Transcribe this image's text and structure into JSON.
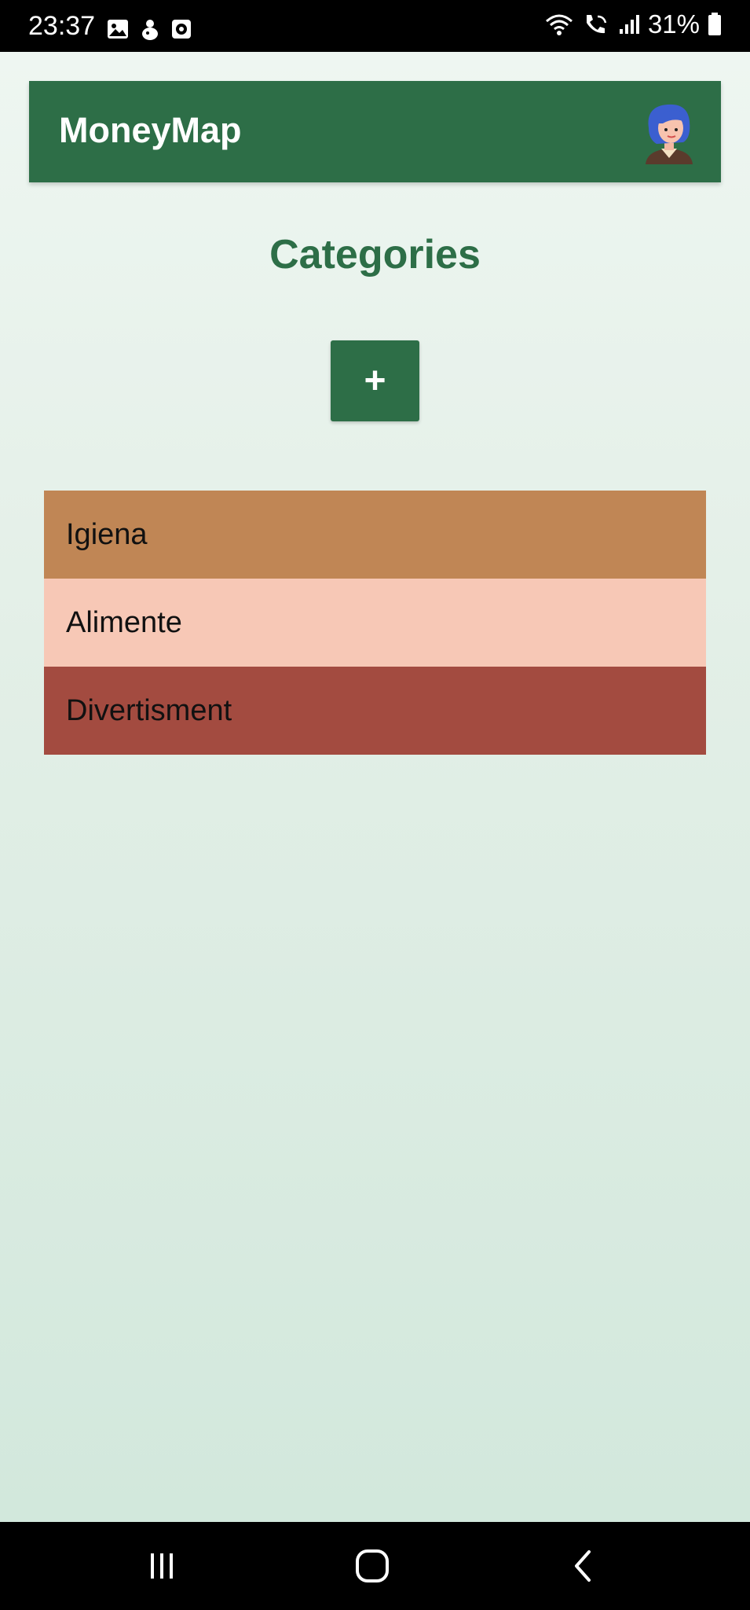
{
  "status_bar": {
    "time": "23:37",
    "battery": "31%",
    "left_icons": [
      "gallery-icon",
      "notification-icon",
      "clock-app-icon"
    ],
    "right_icons": [
      "wifi-icon",
      "wifi-calling-icon",
      "signal-icon",
      "battery-icon"
    ]
  },
  "header": {
    "title": "MoneyMap",
    "avatar_icon": "user-avatar-icon"
  },
  "page": {
    "title": "Categories",
    "add_label": "+"
  },
  "categories": [
    {
      "name": "Igiena",
      "color": "#c08655"
    },
    {
      "name": "Alimente",
      "color": "#f7c8b6"
    },
    {
      "name": "Divertisment",
      "color": "#a34b40"
    }
  ],
  "nav_bar": {
    "icons": [
      "recent-apps-icon",
      "home-icon",
      "back-icon"
    ]
  },
  "colors": {
    "brand": "#2d6e47"
  }
}
